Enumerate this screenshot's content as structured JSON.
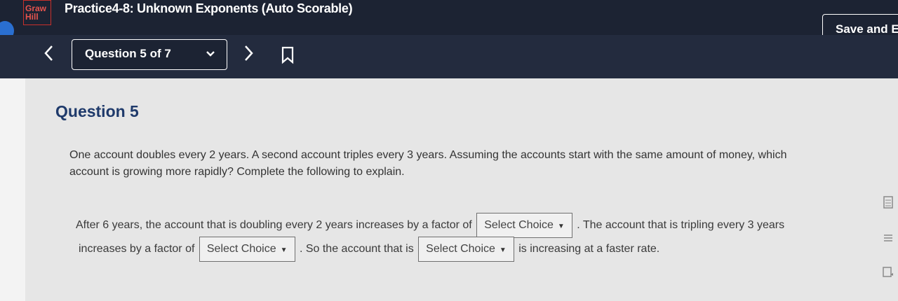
{
  "header": {
    "logo_text": [
      "Graw",
      "Hill"
    ],
    "title": "Practice4-8: Unknown Exponents (Auto Scorable)",
    "save_exit_label": "Save and Ex"
  },
  "nav": {
    "question_select_value": "Question 5 of 7"
  },
  "question": {
    "heading": "Question 5",
    "prompt": "One account doubles every 2 years. A second account triples every 3 years. Assuming the accounts start with the same amount of money, which account is growing more rapidly? Complete the following to explain.",
    "seg1": "After 6 years, the account that is doubling every 2 years increases by a factor of",
    "select1": "Select Choice",
    "seg2": ". The account that is tripling every 3 years",
    "seg3": "increases by a factor of",
    "select2": "Select Choice",
    "seg4": ". So the account that is",
    "select3": "Select Choice",
    "seg5": "is increasing at a faster rate."
  },
  "icons": [
    "chevron-left-icon",
    "chevron-down-icon",
    "chevron-right-icon",
    "bookmark-icon",
    "calculator-icon",
    "menu-icon",
    "notes-icon"
  ]
}
